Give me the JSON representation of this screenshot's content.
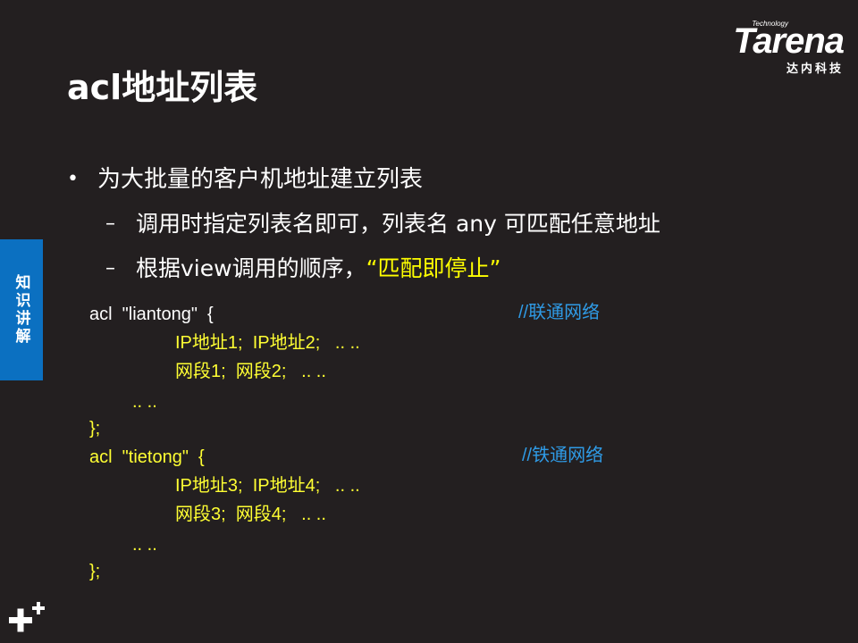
{
  "logo": {
    "tagline": "Technology",
    "word": "Tarena",
    "sub": "达内科技"
  },
  "title": "acl地址列表",
  "side_tab": "知识讲解",
  "bullets": {
    "main": "为大批量的客户机地址建立列表",
    "sub1": "调用时指定列表名即可，列表名  any 可匹配任意地址",
    "sub2_prefix": "根据view调用的顺序，  ",
    "sub2_highlight": "“匹配即停止”"
  },
  "code": {
    "acl1_head": "acl  \"liantong\"  {",
    "acl1_comment": "//联通网络",
    "acl1_ips": "IP地址1;  IP地址2;   .. ..",
    "acl1_segs": "网段1;  网段2;   .. ..",
    "acl1_more": ".. ..",
    "acl1_end": "};",
    "acl2_head": "acl  \"tietong\"  {",
    "acl2_comment": "//铁通网络",
    "acl2_ips": "IP地址3;  IP地址4;   .. ..",
    "acl2_segs": "网段3;  网段4;   .. ..",
    "acl2_more": ".. ..",
    "acl2_end": "};"
  },
  "colors": {
    "background": "#231f20",
    "tab_blue": "#0b70c1",
    "code_yellow": "#ffff33",
    "comment_blue": "#2f9be6"
  },
  "icons": {
    "bottom_left": "plus-plus-icon"
  }
}
